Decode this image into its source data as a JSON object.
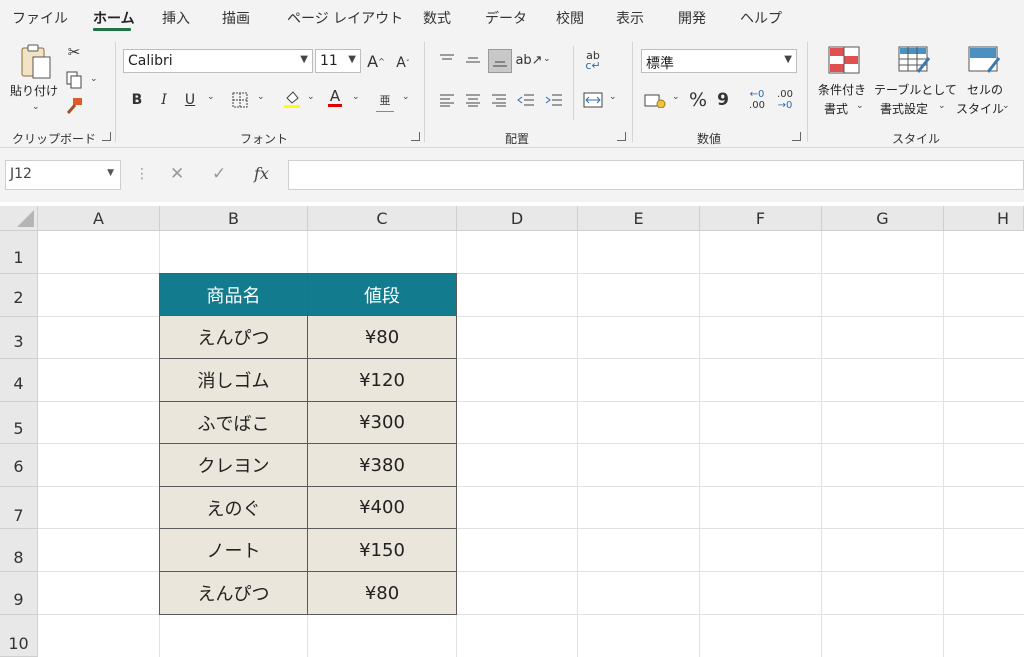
{
  "menu": {
    "tabs": [
      "ファイル",
      "ホーム",
      "挿入",
      "描画",
      "ページ レイアウト",
      "数式",
      "データ",
      "校閲",
      "表示",
      "開発",
      "ヘルプ"
    ],
    "active": "ホーム"
  },
  "ribbon": {
    "clipboard": {
      "paste_label": "貼り付け",
      "group_label": "クリップボード"
    },
    "font": {
      "font_name": "Calibri",
      "font_size": "11",
      "group_label": "フォント",
      "bold": "B",
      "italic": "I",
      "underline": "U",
      "grow": "A",
      "shrink": "A",
      "font_color": "A",
      "phonetic": "亜"
    },
    "alignment": {
      "group_label": "配置"
    },
    "number": {
      "format": "標準",
      "group_label": "数値",
      "percent": "%",
      "comma": "9",
      "inc_decimal": ".00",
      "dec_decimal": ".00"
    },
    "styles": {
      "cond_format_line1": "条件付き",
      "cond_format_line2": "書式",
      "table_format_line1": "テーブルとして",
      "table_format_line2": "書式設定",
      "cell_styles_line1": "セルの",
      "cell_styles_line2": "スタイル",
      "group_label": "スタイル"
    }
  },
  "formula_bar": {
    "name_box": "J12",
    "fx": "fx",
    "value": ""
  },
  "grid": {
    "columns": [
      "A",
      "B",
      "C",
      "D",
      "E",
      "F",
      "G",
      "H"
    ],
    "rows": [
      "1",
      "2",
      "3",
      "4",
      "5",
      "6",
      "7",
      "8",
      "9",
      "10"
    ]
  },
  "table": {
    "headers": [
      "商品名",
      "値段"
    ],
    "rows": [
      [
        "えんぴつ",
        "¥80"
      ],
      [
        "消しゴム",
        "¥120"
      ],
      [
        "ふでばこ",
        "¥300"
      ],
      [
        "クレヨン",
        "¥380"
      ],
      [
        "えのぐ",
        "¥400"
      ],
      [
        "ノート",
        "¥150"
      ],
      [
        "えんぴつ",
        "¥80"
      ]
    ]
  },
  "colors": {
    "header_fill": "#127c8e",
    "body_fill": "#ebe6dc",
    "accent": "#217346"
  }
}
